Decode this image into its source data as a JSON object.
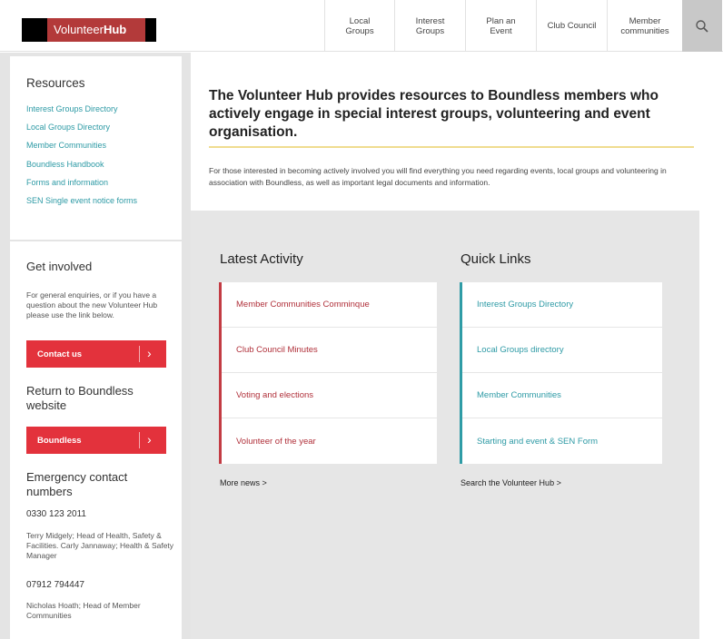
{
  "header": {
    "logo_text": "Volunteer",
    "logo_bold": "Hub",
    "nav": [
      {
        "line1": "Local",
        "line2": "Groups"
      },
      {
        "line1": "Interest",
        "line2": "Groups"
      },
      {
        "line1": "Plan an",
        "line2": "Event"
      },
      {
        "line1": "Club Council",
        "line2": ""
      },
      {
        "line1": "Member",
        "line2": "communities"
      }
    ]
  },
  "sidebar": {
    "resources_title": "Resources",
    "resources": [
      "Interest Groups Directory",
      "Local Groups Directory",
      "Member Communities",
      "Boundless Handbook",
      "Forms and information",
      "SEN Single event notice forms"
    ],
    "get_involved_title": "Get involved",
    "get_involved_text": "For general enquiries, or if you have a question about the new Volunteer Hub please use the link below.",
    "contact_button": "Contact us",
    "return_title": "Return to Boundless website",
    "boundless_button": "Boundless",
    "emergency_title": "Emergency contact numbers",
    "phone1": "0330 123 2011",
    "contact1": "Terry Midgely; Head of Health, Safety & Facilities. Carly Jannaway; Health & Safety Manager",
    "phone2": "07912 794447",
    "contact2": "Nicholas Hoath; Head of Member Communities"
  },
  "main": {
    "intro": "The Volunteer Hub provides resources to Boundless members who actively engage in special interest groups, volunteering and event organisation.",
    "intro_sub": "For those interested in becoming actively involved you will find everything you need regarding events, local groups and volunteering in association with Boundless, as well as important legal documents and information.",
    "latest_title": "Latest Activity",
    "latest_items": [
      "Member Communities Comminque",
      "Club Council Minutes",
      "Voting and elections",
      "Volunteer of the year"
    ],
    "more_news": "More news >",
    "quick_title": "Quick Links",
    "quick_items": [
      "Interest Groups Directory",
      "Local Groups directory",
      "Member Communities",
      "Starting and event & SEN Form"
    ],
    "search_hub": "Search the Volunteer Hub >"
  },
  "colors": {
    "brand_red": "#e3323c",
    "teal": "#2d9aa5",
    "dark_red": "#b0303a"
  }
}
